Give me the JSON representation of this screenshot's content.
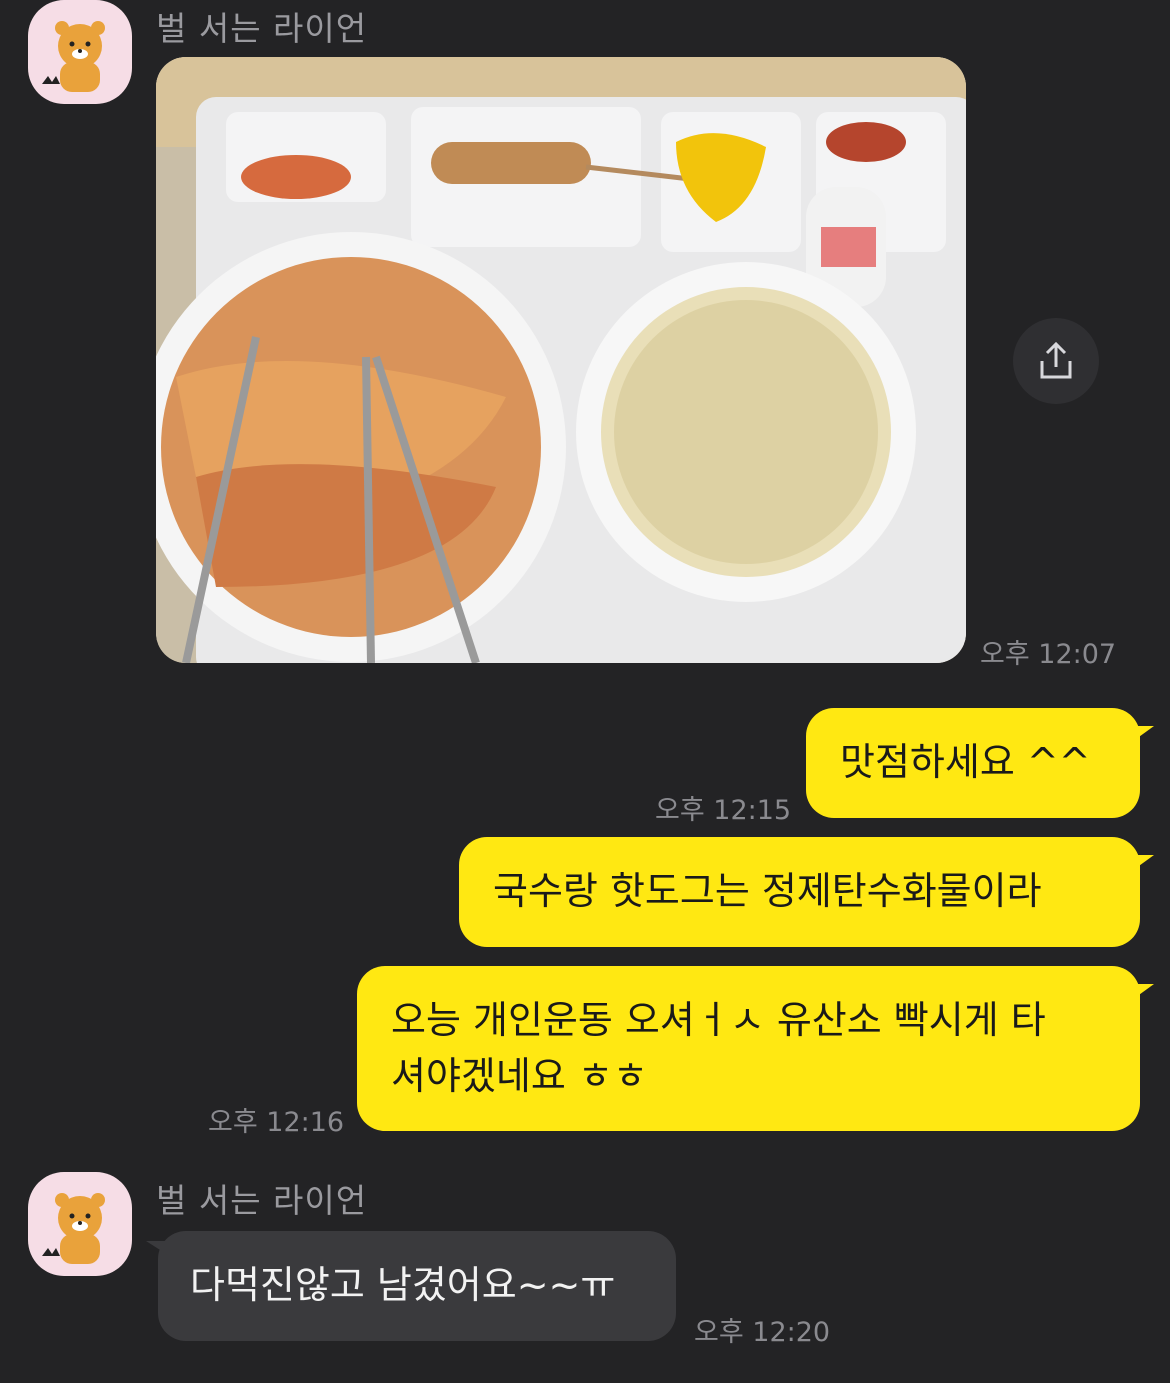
{
  "sender_name": "벌 서는 라이언",
  "messages": {
    "photo": {
      "time": "오후 12:07"
    },
    "m1": {
      "text": "맛점하세요 ^^",
      "time": "오후 12:15"
    },
    "m2": {
      "text": "국수랑 핫도그는 정제탄수화물이라"
    },
    "m3": {
      "line1": "오능 개인운동 오셔ㅓㅅ 유산소 빡시게 타",
      "line2": "셔야겠네요 ㅎㅎ",
      "time": "오후 12:16"
    },
    "m4": {
      "text": "다먹진않고 남겼어요~~ㅠ",
      "time": "오후 12:20"
    }
  },
  "icons": {
    "share": "share-icon",
    "avatar": "ryan-avatar"
  },
  "colors": {
    "background": "#232325",
    "my_bubble": "#ffe812",
    "their_bubble": "#3a3a3d"
  }
}
